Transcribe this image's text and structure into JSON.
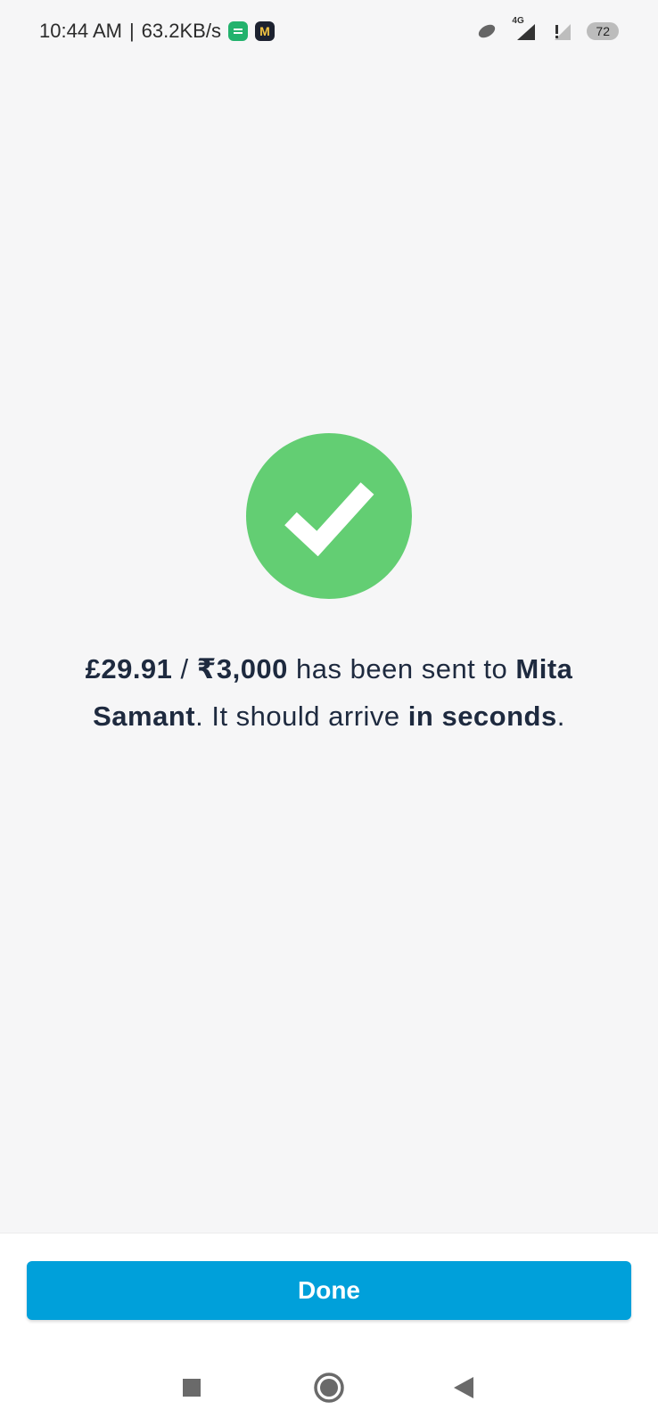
{
  "status_bar": {
    "time": "10:44 AM",
    "separator": "|",
    "network_speed": "63.2KB/s",
    "network_type": "4G",
    "battery": "72",
    "icons": [
      "messaging-app-icon",
      "m-app-icon",
      "link-icon",
      "signal-icon",
      "sim-signal-icon",
      "battery-icon"
    ]
  },
  "success": {
    "icon": "checkmark-icon",
    "icon_color": "#63ce73",
    "amount_gbp": "£29.91",
    "amount_sep": " / ",
    "amount_inr": "₹3,000",
    "sent_text": " has been sent to",
    "recipient": "Mita Samant",
    "arrival_prefix": ". It should arrive ",
    "arrival_time_part1": "in",
    "arrival_time_part2": "seconds",
    "arrival_suffix": "."
  },
  "actions": {
    "done_label": "Done",
    "accent": "#00a0da"
  },
  "nav_bar": {
    "recents": "square-recents-icon",
    "home": "circle-home-icon",
    "back": "triangle-back-icon"
  }
}
